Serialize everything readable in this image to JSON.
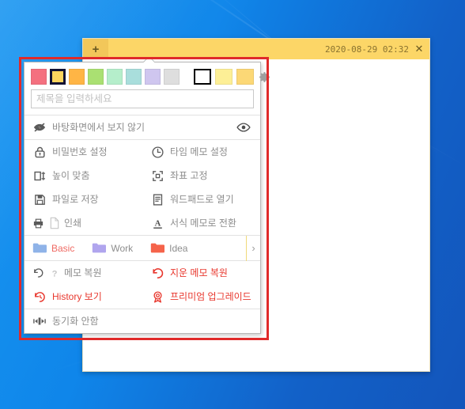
{
  "window": {
    "add_tab_label": "+",
    "timestamp": "2020-08-29 02:32",
    "close_label": "✕"
  },
  "popup": {
    "palette": {
      "swatches": [
        {
          "name": "color-coral",
          "hex": "#f4707f",
          "selected": false
        },
        {
          "name": "color-yellow",
          "hex": "#fcd45e",
          "selected": true
        },
        {
          "name": "color-orange",
          "hex": "#ffb545",
          "selected": false
        },
        {
          "name": "color-green",
          "hex": "#aae072",
          "selected": false
        },
        {
          "name": "color-mint",
          "hex": "#b5eecb",
          "selected": false
        },
        {
          "name": "color-teal",
          "hex": "#a9dedc",
          "selected": false
        },
        {
          "name": "color-lavender",
          "hex": "#cfc6ef",
          "selected": false
        },
        {
          "name": "color-gray",
          "hex": "#dedede",
          "selected": false
        }
      ],
      "shades": [
        {
          "name": "shade-white",
          "hex": "#ffffff",
          "selected": true
        },
        {
          "name": "shade-light",
          "hex": "#fdef96",
          "selected": false
        },
        {
          "name": "shade-medium",
          "hex": "#fcd876",
          "selected": false
        }
      ],
      "settings_icon": "gear-icon"
    },
    "title_input": {
      "placeholder": "제목을 입력하세요",
      "value": ""
    },
    "menu": {
      "hide_on_desktop": "바탕화면에서 보지 않기",
      "set_password": "비밀번호 설정",
      "set_time_memo": "타임 메모 설정",
      "fit_height": "높이 맞춤",
      "lock_position": "좌표 고정",
      "save_to_file": "파일로 저장",
      "open_wordpad": "워드패드로 열기",
      "print": "인쇄",
      "convert_format_memo": "서식 메모로 전환",
      "restore_memo": "메모 복원",
      "restore_deleted_memo": "지운 메모 복원",
      "view_history": "History 보기",
      "premium_upgrade": "프리미엄 업그레이드",
      "no_sync": "동기화 안함"
    },
    "folders": [
      {
        "label": "Basic",
        "color": "#8fb3e8",
        "active": true
      },
      {
        "label": "Work",
        "color": "#b0a5ee",
        "active": false
      },
      {
        "label": "Idea",
        "color": "#f5634a",
        "active": false
      }
    ],
    "folder_next_label": "›"
  },
  "colors": {
    "accent_red": "#e8372d",
    "titlebar": "#fcd667",
    "annotation": "#e02a2a"
  }
}
